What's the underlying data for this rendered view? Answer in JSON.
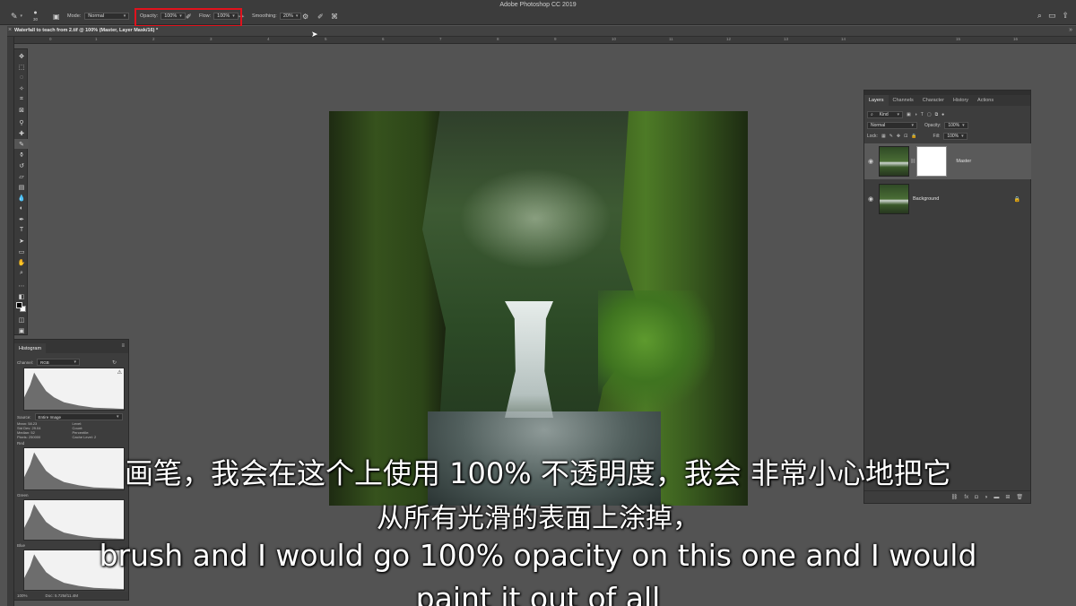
{
  "app": {
    "title": "Adobe Photoshop CC 2019"
  },
  "options_bar": {
    "mode_label": "Mode:",
    "mode_value": "Normal",
    "brush_size": "30",
    "opacity_label": "Opacity:",
    "opacity_value": "100%",
    "flow_label": "Flow:",
    "flow_value": "100%",
    "smoothing_label": "Smoothing:",
    "smoothing_value": "20%",
    "highlight_color": "#e0121d"
  },
  "document": {
    "tab_title": "Waterfall to teach from 2.tif @ 100% (Master, Layer Mask/16) *"
  },
  "ruler": {
    "top_numbers": [
      "1",
      "0",
      "1",
      "2",
      "3",
      "4",
      "5",
      "6",
      "7",
      "8",
      "9",
      "10",
      "11",
      "12",
      "13",
      "14",
      "15",
      "16",
      "17"
    ]
  },
  "layers_panel": {
    "tabs": [
      "Layers",
      "Channels",
      "Character",
      "History",
      "Actions"
    ],
    "active_tab": "Layers",
    "filter_label": "Kind",
    "blend_mode": "Normal",
    "opacity_label": "Opacity:",
    "opacity_value": "100%",
    "lock_label": "Lock:",
    "fill_label": "Fill:",
    "fill_value": "100%",
    "layers": [
      {
        "name": "Master",
        "selected": true,
        "has_mask": true,
        "locked": false
      },
      {
        "name": "Background",
        "selected": false,
        "has_mask": false,
        "locked": true
      }
    ]
  },
  "histogram_panel": {
    "tab": "Histogram",
    "channel_label": "Channel:",
    "channel_value": "RGB",
    "source_label": "Source:",
    "source_value": "Entire Image",
    "stats": {
      "mean_label": "Mean:",
      "mean": "58.23",
      "std_dev_label": "Std Dev:",
      "std_dev": "29.04",
      "median_label": "Median:",
      "median": "52",
      "pixels_label": "Pixels:",
      "pixels": "250000",
      "level_label": "Level:",
      "count_label": "Count:",
      "percentile_label": "Percentile:",
      "cache_label": "Cache Level:",
      "cache_level": "2"
    },
    "channels": [
      "Red",
      "Green",
      "Blue"
    ],
    "status_zoom": "100%",
    "status_doc": "Doc: 5.72M/11.4M"
  },
  "subtitles": {
    "zh_line1": "画笔，我会在这个上使用 100% 不透明度，我会 非常小心地把它",
    "zh_line2": "从所有光滑的表面上涂掉，",
    "en_line1": "brush and I would go 100% opacity on this one and I would",
    "en_line2": "paint it out of all"
  }
}
